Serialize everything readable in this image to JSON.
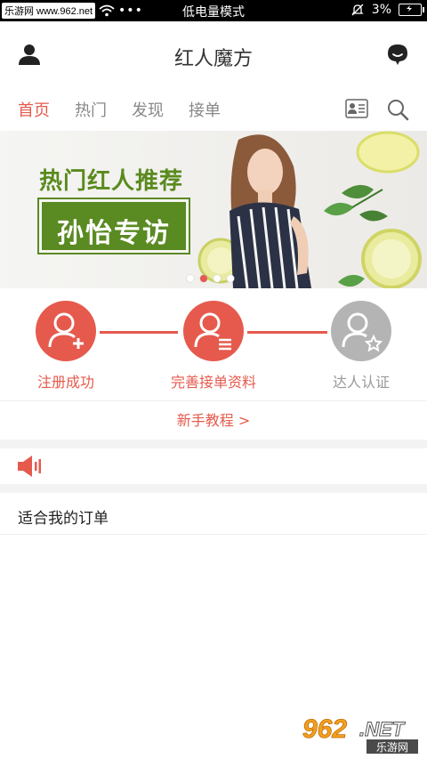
{
  "statusbar": {
    "site": "乐游网 www.962.net",
    "mode": "低电量模式",
    "battery": "3%"
  },
  "appbar": {
    "title": "红人魔方"
  },
  "tabs": [
    {
      "label": "首页",
      "active": true
    },
    {
      "label": "热门",
      "active": false
    },
    {
      "label": "发现",
      "active": false
    },
    {
      "label": "接单",
      "active": false
    }
  ],
  "banner": {
    "headline": "热门红人推荐",
    "subtitle": "孙怡专访",
    "current_slide": 2,
    "slides": 4
  },
  "steps": [
    {
      "label": "注册成功",
      "state": "done"
    },
    {
      "label": "完善接单资料",
      "state": "done"
    },
    {
      "label": "达人认证",
      "state": "pending"
    }
  ],
  "tutorial": {
    "label": "新手教程 >"
  },
  "orders": {
    "title": "适合我的订单"
  },
  "colors": {
    "accent": "#e55a4d",
    "gray": "#b4b4b4",
    "banner_green": "#5a8a22"
  },
  "watermark": {
    "number": "962",
    "suffix": ".NET",
    "caption": "乐游网"
  }
}
